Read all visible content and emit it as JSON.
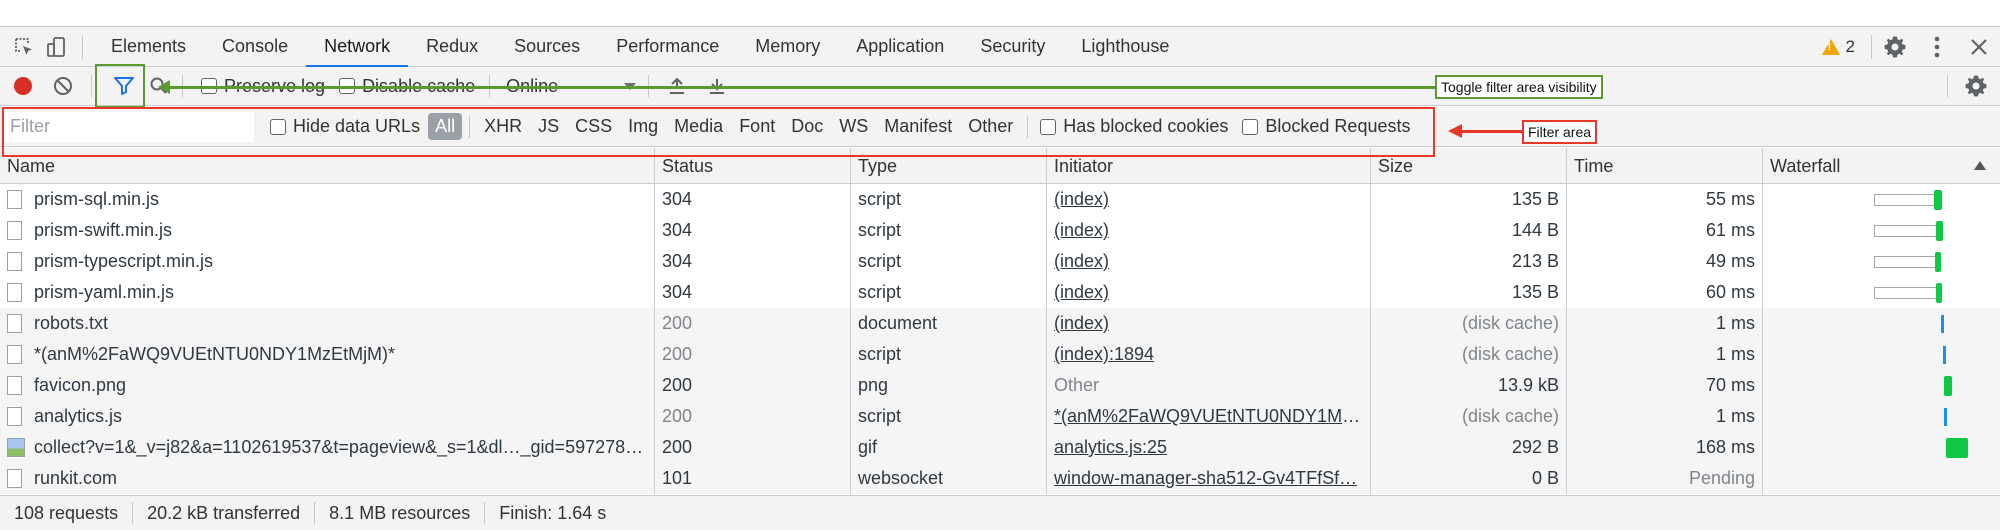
{
  "tabs": [
    "Elements",
    "Console",
    "Network",
    "Redux",
    "Sources",
    "Performance",
    "Memory",
    "Application",
    "Security",
    "Lighthouse"
  ],
  "active_tab": "Network",
  "warnings_count": "2",
  "toolbar": {
    "preserve_log": "Preserve log",
    "disable_cache": "Disable cache",
    "throttling": "Online"
  },
  "filter": {
    "placeholder": "Filter",
    "hide_data_urls": "Hide data URLs",
    "types": [
      "All",
      "XHR",
      "JS",
      "CSS",
      "Img",
      "Media",
      "Font",
      "Doc",
      "WS",
      "Manifest",
      "Other"
    ],
    "selected_type": "All",
    "has_blocked_cookies": "Has blocked cookies",
    "blocked_requests": "Blocked Requests"
  },
  "annotations": {
    "toggle_filter": "Toggle filter area visibility",
    "filter_area": "Filter area",
    "toggle_color": "#5b9a2e",
    "filter_color": "#e8382a"
  },
  "columns": [
    "Name",
    "Status",
    "Type",
    "Initiator",
    "Size",
    "Time",
    "Waterfall"
  ],
  "rows": [
    {
      "name": "prism-sql.min.js",
      "status": "304",
      "type": "script",
      "initiator": "(index)",
      "size": "135 B",
      "time": "55 ms",
      "icon": "document-icon"
    },
    {
      "name": "prism-swift.min.js",
      "status": "304",
      "type": "script",
      "initiator": "(index)",
      "size": "144 B",
      "time": "61 ms",
      "icon": "document-icon"
    },
    {
      "name": "prism-typescript.min.js",
      "status": "304",
      "type": "script",
      "initiator": "(index)",
      "size": "213 B",
      "time": "49 ms",
      "icon": "document-icon"
    },
    {
      "name": "prism-yaml.min.js",
      "status": "304",
      "type": "script",
      "initiator": "(index)",
      "size": "135 B",
      "time": "60 ms",
      "icon": "document-icon"
    },
    {
      "name": "robots.txt",
      "status": "200",
      "type": "document",
      "initiator": "(index)",
      "size": "(disk cache)",
      "time": "1 ms",
      "icon": "document-icon"
    },
    {
      "name": "*(anM%2FaWQ9VUEtNTU0NDY1MzEtMjM)*",
      "status": "200",
      "type": "script",
      "initiator": "(index):1894",
      "size": "(disk cache)",
      "time": "1 ms",
      "icon": "document-icon"
    },
    {
      "name": "favicon.png",
      "status": "200",
      "type": "png",
      "initiator": "Other",
      "size": "13.9 kB",
      "time": "70 ms",
      "icon": "document-icon"
    },
    {
      "name": "analytics.js",
      "status": "200",
      "type": "script",
      "initiator": "*(anM%2FaWQ9VUEtNTU0NDY1Mz…",
      "size": "(disk cache)",
      "time": "1 ms",
      "icon": "document-icon"
    },
    {
      "name": "collect?v=1&_v=j82&a=1102619537&t=pageview&_s=1&dl…_gid=597278…",
      "status": "200",
      "type": "gif",
      "initiator": "analytics.js:25",
      "size": "292 B",
      "time": "168 ms",
      "icon": "image-icon"
    },
    {
      "name": "runkit.com",
      "status": "101",
      "type": "websocket",
      "initiator": "window-manager-sha512-Gv4TFfSf…",
      "size": "0 B",
      "time": "Pending",
      "icon": "document-icon"
    }
  ],
  "statusbar": {
    "requests": "108 requests",
    "transferred": "20.2 kB transferred",
    "resources": "8.1 MB resources",
    "finish": "Finish: 1.64 s"
  }
}
